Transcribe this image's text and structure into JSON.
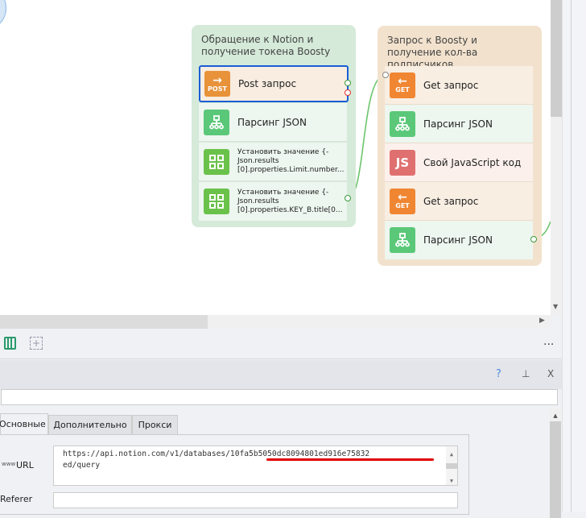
{
  "groups": [
    {
      "title": "Обращение к Notion и получение токена Boosty",
      "blocks": [
        {
          "icon": "post-arrow-icon",
          "badge": "POST",
          "label": "Post запрос"
        },
        {
          "icon": "json-tree-icon",
          "label": "Парсинг JSON"
        },
        {
          "icon": "grid-icon",
          "label": "Установить значение {-Json.results [0].properties.Limit.number..."
        },
        {
          "icon": "grid-icon",
          "label": "Установить значение {-Json.results [0].properties.KEY_B.title[0..."
        }
      ]
    },
    {
      "title": "Запрос к Boosty и получение кол-ва подписчиков",
      "blocks": [
        {
          "icon": "get-arrow-icon",
          "badge": "GET",
          "label": "Get запрос"
        },
        {
          "icon": "json-tree-icon",
          "label": "Парсинг JSON"
        },
        {
          "icon": "js-icon",
          "badge": "JS",
          "label": "Свой JavaScript код"
        },
        {
          "icon": "get-arrow-icon",
          "badge": "GET",
          "label": "Get запрос"
        },
        {
          "icon": "json-tree-icon",
          "label": "Парсинг JSON"
        }
      ]
    }
  ],
  "toolbar": {
    "more": "..."
  },
  "panel": {
    "help": "?",
    "close": "X",
    "name_value": "",
    "tabs": [
      "Основные",
      "Дополнительно",
      "Прокси"
    ],
    "url_label": "URL",
    "www": "www",
    "url_value": "https://api.notion.com/v1/databases/10fa5b5050dc8094801ed916e75832ed/query",
    "url_line1": "https://api.notion.com/v1/databases/10fa5b5050dc8094801ed916e75832",
    "url_line2": "ed/query",
    "referer_label": "Referer",
    "referer_value": ""
  },
  "colors": {
    "green_group": "#d5ead9",
    "orange_group": "#f2e2cd",
    "post": "#e8923a",
    "get": "#f08632",
    "json": "#5ac878",
    "js": "#e07070",
    "set": "#6ac24a",
    "selection": "#1a5ed6",
    "underline": "#e00000"
  }
}
